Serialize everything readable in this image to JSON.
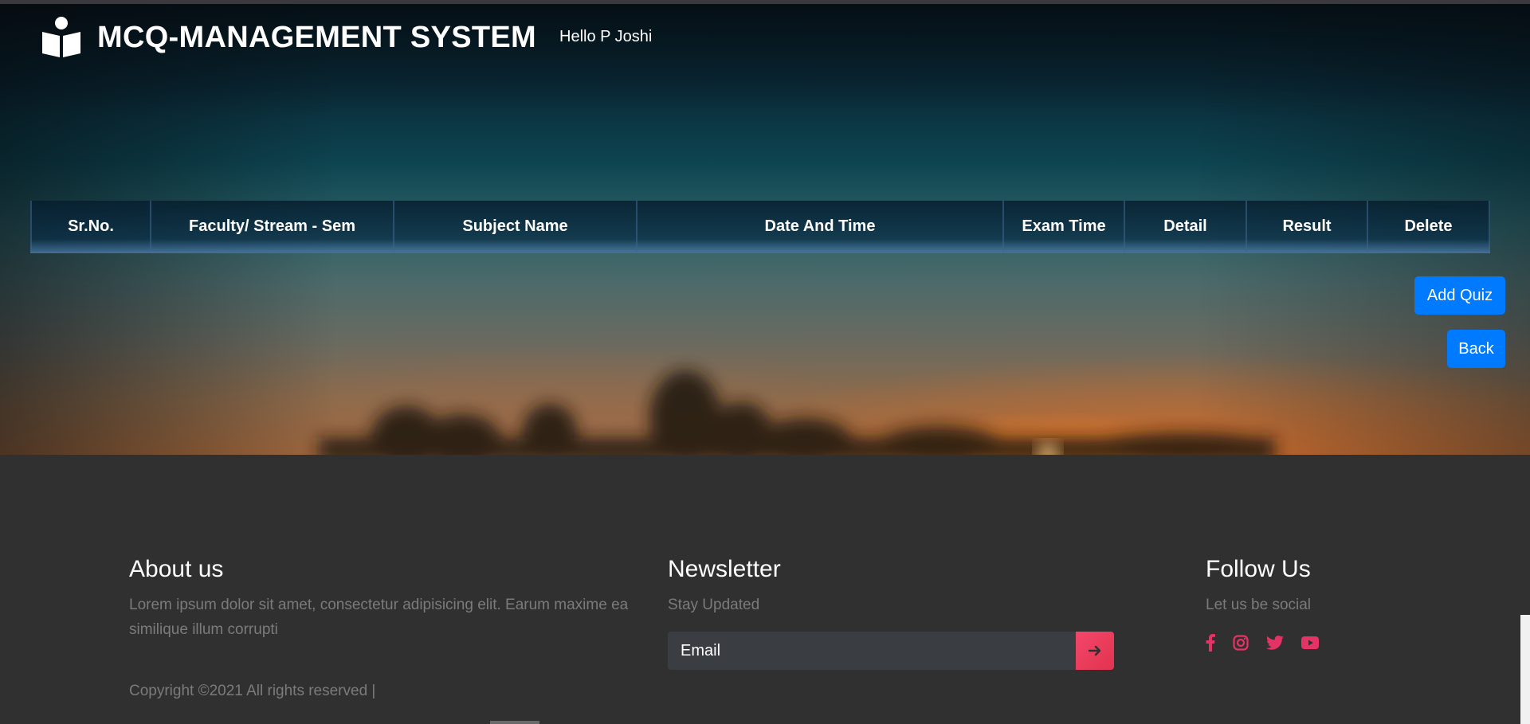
{
  "header": {
    "brand_icon": "reading-book-icon",
    "title": "MCQ-MANAGEMENT SYSTEM",
    "greeting": "Hello P Joshi"
  },
  "table": {
    "columns": [
      "Sr.No.",
      "Faculty/ Stream - Sem",
      "Subject Name",
      "Date And Time",
      "Exam Time",
      "Detail",
      "Result",
      "Delete"
    ],
    "rows": []
  },
  "actions": {
    "add_quiz": "Add Quiz",
    "back": "Back",
    "color": "#007bff"
  },
  "footer": {
    "about": {
      "title": "About us",
      "text": "Lorem ipsum dolor sit amet, consectetur adipisicing elit. Earum maxime ea similique illum corrupti"
    },
    "newsletter": {
      "title": "Newsletter",
      "subtitle": "Stay Updated",
      "email_placeholder": "Email",
      "submit_icon": "arrow-right-icon"
    },
    "follow": {
      "title": "Follow Us",
      "subtitle": "Let us be social",
      "icons": [
        "facebook-icon",
        "instagram-icon",
        "twitter-icon",
        "youtube-icon"
      ],
      "icon_color": "#e63365"
    },
    "copyright": "Copyright ©2021 All rights reserved |"
  }
}
